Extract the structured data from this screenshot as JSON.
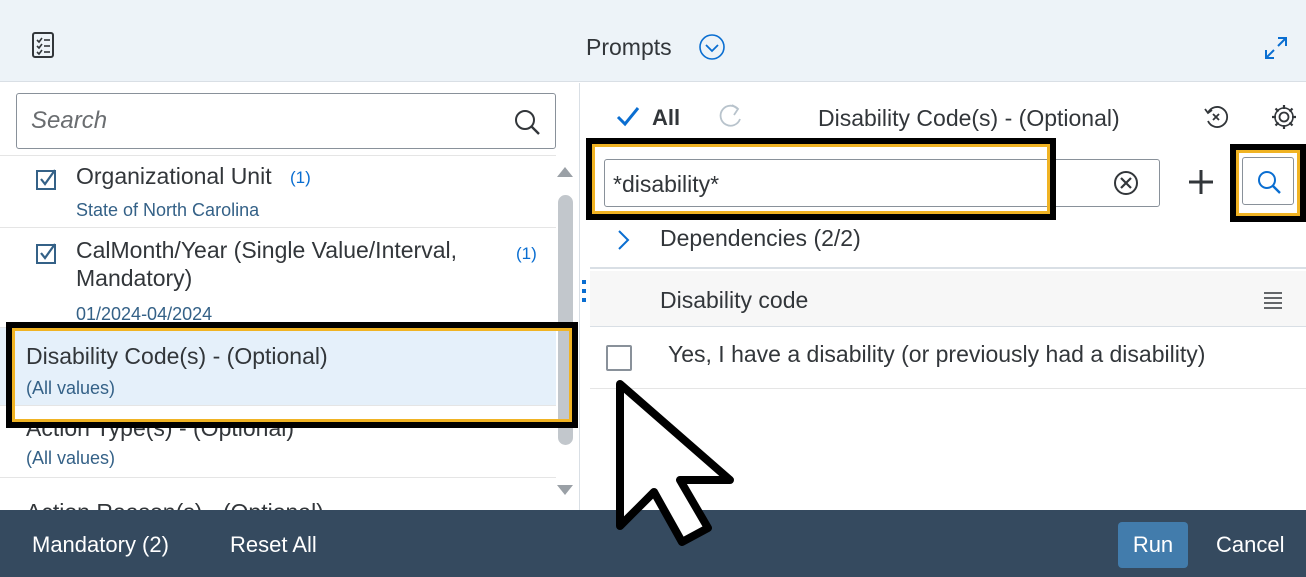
{
  "header": {
    "title": "Prompts",
    "left_icon": "checklist-icon",
    "title_icon": "chevron-down-circle-icon",
    "expand_icon": "expand-icon"
  },
  "left_pane": {
    "search": {
      "placeholder": "Search",
      "value": ""
    },
    "items": [
      {
        "title": "Organizational Unit",
        "count": "(1)",
        "subtitle": "State of North Carolina",
        "checked": true
      },
      {
        "title_line1": "CalMonth/Year (Single Value/Interval,",
        "title_line2": "Mandatory)",
        "count": "(1)",
        "subtitle": "01/2024-04/2024",
        "checked": true
      },
      {
        "title": "Disability Code(s) - (Optional)",
        "subtitle": "(All values)",
        "selected": true
      },
      {
        "title": "Action Type(s) - (Optional)",
        "subtitle": "(All values)"
      },
      {
        "title": "Action Reason(s) - (Optional)"
      }
    ]
  },
  "right_pane": {
    "toolbar": {
      "all_label": "All",
      "title": "Disability Code(s) - (Optional)"
    },
    "filter": {
      "value": "*disability*"
    },
    "dependencies": "Dependencies (2/2)",
    "column_header": "Disability code",
    "values": [
      {
        "label": "Yes, I have a disability (or previously had a disability)",
        "checked": false
      }
    ]
  },
  "footer": {
    "mandatory": "Mandatory (2)",
    "reset_all": "Reset All",
    "run": "Run",
    "cancel": "Cancel"
  },
  "colors": {
    "header_bg": "#edf3f8",
    "footer_bg": "#354a5f",
    "run_button": "#427cac",
    "selected_row": "#e5f0fa",
    "highlight_outer": "#000000",
    "highlight_inner": "#f0b323",
    "link_blue": "#346187"
  }
}
